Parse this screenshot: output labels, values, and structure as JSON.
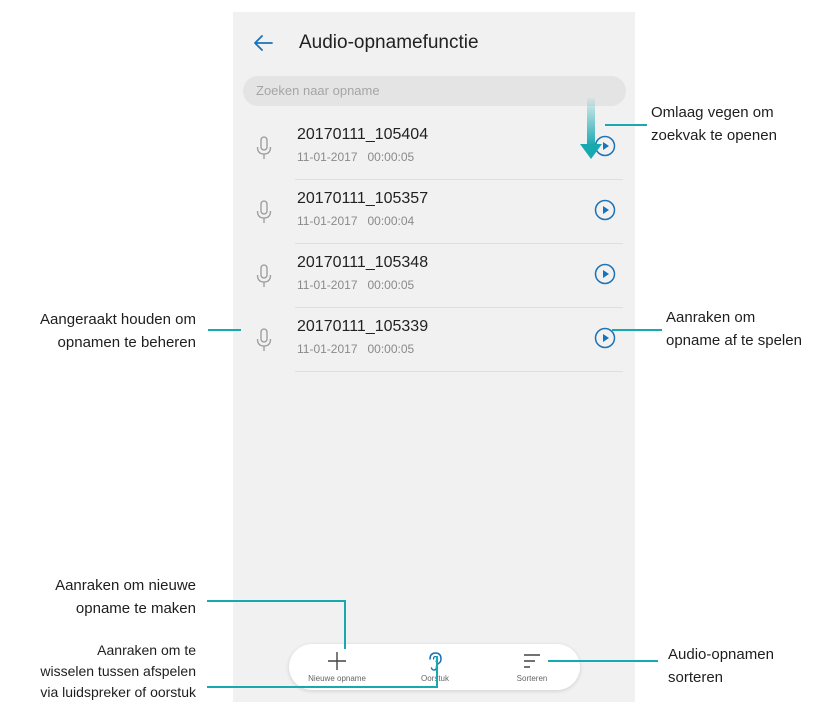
{
  "header": {
    "title": "Audio-opnamefunctie",
    "back_icon": "arrow-left-icon"
  },
  "search": {
    "placeholder": "Zoeken naar opname"
  },
  "recordings": [
    {
      "name": "20170111_105404",
      "date": "11-01-2017",
      "duration": "00:00:05"
    },
    {
      "name": "20170111_105357",
      "date": "11-01-2017",
      "duration": "00:00:04"
    },
    {
      "name": "20170111_105348",
      "date": "11-01-2017",
      "duration": "00:00:05"
    },
    {
      "name": "20170111_105339",
      "date": "11-01-2017",
      "duration": "00:00:05"
    }
  ],
  "toolbar": {
    "new_label": "Nieuwe opname",
    "earpiece_label": "Oorstuk",
    "sort_label": "Sorteren"
  },
  "callouts": {
    "swipe": [
      "Omlaag vegen om",
      "zoekvak te openen"
    ],
    "play": [
      "Aanraken om",
      "opname af te spelen"
    ],
    "hold": [
      "Aangeraakt houden om",
      "opnamen te beheren"
    ],
    "new": [
      "Aanraken om nieuwe",
      "opname te maken"
    ],
    "switch": [
      "Aanraken om te",
      "wisselen tussen afspelen",
      "via luidspreker of oorstuk"
    ],
    "sort": [
      "Audio-opnamen",
      "sorteren"
    ]
  },
  "colors": {
    "accent": "#1a72b8",
    "callout_line": "#17a8b0",
    "screen_bg": "#f1f1f1"
  }
}
